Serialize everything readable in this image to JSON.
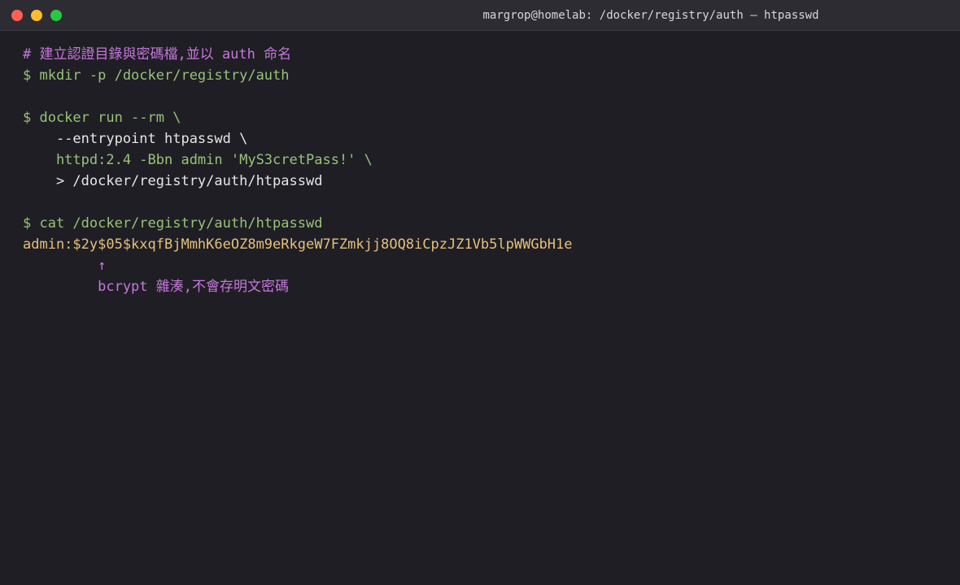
{
  "window": {
    "title": "margrop@homelab: /docker/registry/auth — htpasswd"
  },
  "terminal": {
    "comment": "# 建立認證目錄與密碼檔,並以 auth 命名",
    "cmd_mkdir": "$ mkdir -p /docker/registry/auth",
    "cmd_run_1": "$ docker run --rm \\",
    "cmd_run_2": "    --entrypoint htpasswd \\",
    "cmd_run_3": "    httpd:2.4 -Bbn admin 'MyS3cretPass!' \\",
    "cmd_run_4": "    > /docker/registry/auth/htpasswd",
    "cmd_cat": "$ cat /docker/registry/auth/htpasswd",
    "output_hash": "admin:$2y$05$kxqfBjMmhK6eOZ8m9eRkgeW7FZmkjj8OQ8iCpzJZ1Vb5lpWWGbH1e",
    "arrow": "         ↑",
    "annotation": "         bcrypt 雜湊,不會存明文密碼"
  }
}
